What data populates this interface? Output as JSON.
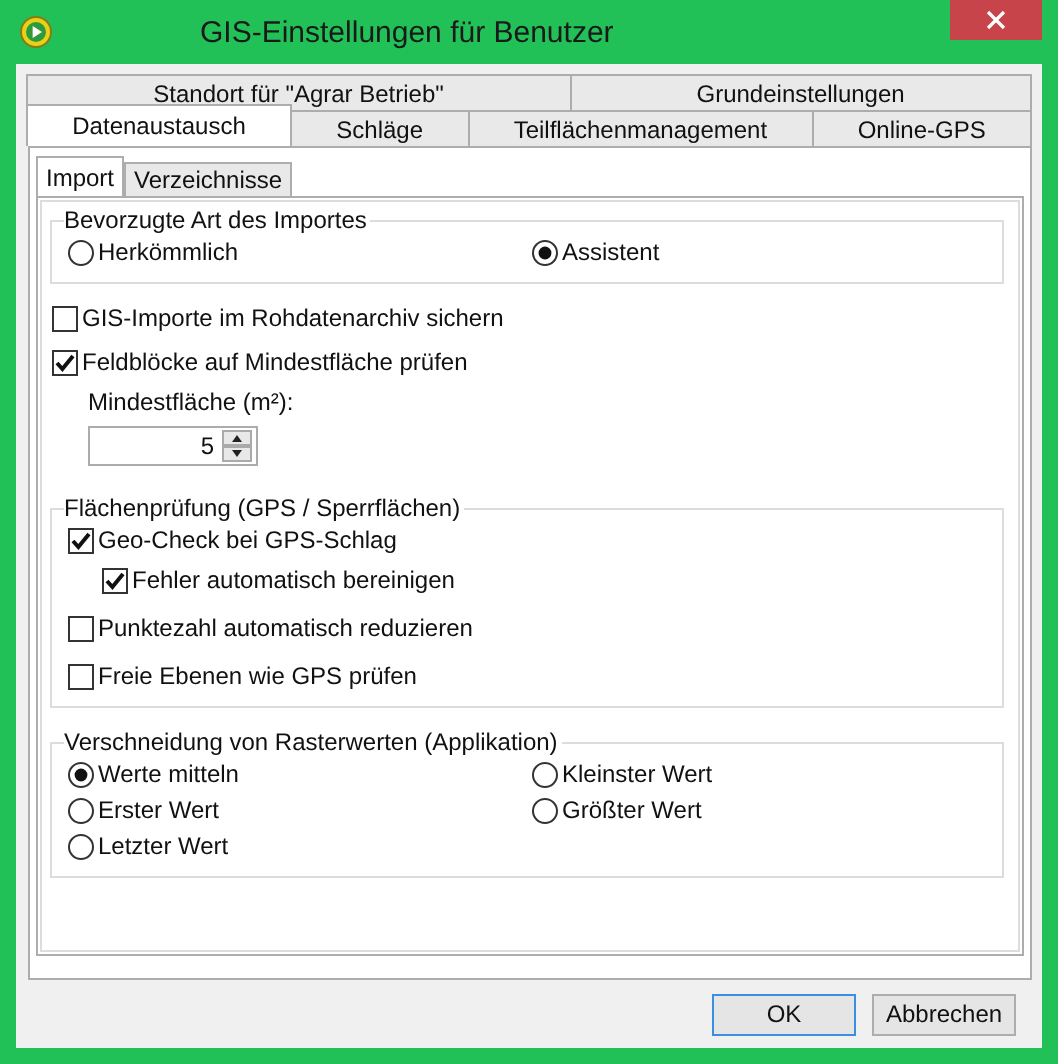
{
  "window": {
    "title": "GIS-Einstellungen für Benutzer"
  },
  "tab_rows": [
    {
      "tabs": [
        {
          "label": "Standort für \"Agrar Betrieb\"",
          "selected": false
        },
        {
          "label": "Grundeinstellungen",
          "selected": false
        }
      ]
    },
    {
      "tabs": [
        {
          "label": "Datenaustausch",
          "selected": true
        },
        {
          "label": "Schläge",
          "selected": false
        },
        {
          "label": "Teilflächenmanagement",
          "selected": false
        },
        {
          "label": "Online-GPS",
          "selected": false
        }
      ]
    }
  ],
  "subtabs": [
    {
      "label": "Import",
      "selected": true
    },
    {
      "label": "Verzeichnisse",
      "selected": false
    }
  ],
  "import_type": {
    "legend": "Bevorzugte Art des Importes",
    "options": [
      {
        "label": "Herkömmlich",
        "selected": false
      },
      {
        "label": "Assistent",
        "selected": true
      }
    ]
  },
  "options": [
    {
      "label": "GIS-Importe im Rohdatenarchiv sichern",
      "checked": false
    },
    {
      "label": "Feldblöcke auf Mindestfläche prüfen",
      "checked": true
    }
  ],
  "min_area": {
    "label": "Mindestfläche (m²):",
    "value": "5"
  },
  "area_check": {
    "legend": "Flächenprüfung (GPS / Sperrflächen)",
    "items": [
      {
        "label": "Geo-Check bei GPS-Schlag",
        "checked": true,
        "children": [
          {
            "label": "Fehler automatisch bereinigen",
            "checked": true
          }
        ]
      },
      {
        "label": "Punktezahl automatisch reduzieren",
        "checked": false
      },
      {
        "label": "Freie Ebenen wie GPS prüfen",
        "checked": false
      }
    ]
  },
  "raster": {
    "legend": "Verschneidung von Rasterwerten (Applikation)",
    "options": [
      {
        "label": "Werte mitteln",
        "selected": true
      },
      {
        "label": "Erster Wert",
        "selected": false
      },
      {
        "label": "Letzter Wert",
        "selected": false
      },
      {
        "label": "Kleinster Wert",
        "selected": false
      },
      {
        "label": "Größter Wert",
        "selected": false
      }
    ]
  },
  "buttons": [
    {
      "label": "OK",
      "default": true
    },
    {
      "label": "Abbrechen",
      "default": false
    }
  ]
}
